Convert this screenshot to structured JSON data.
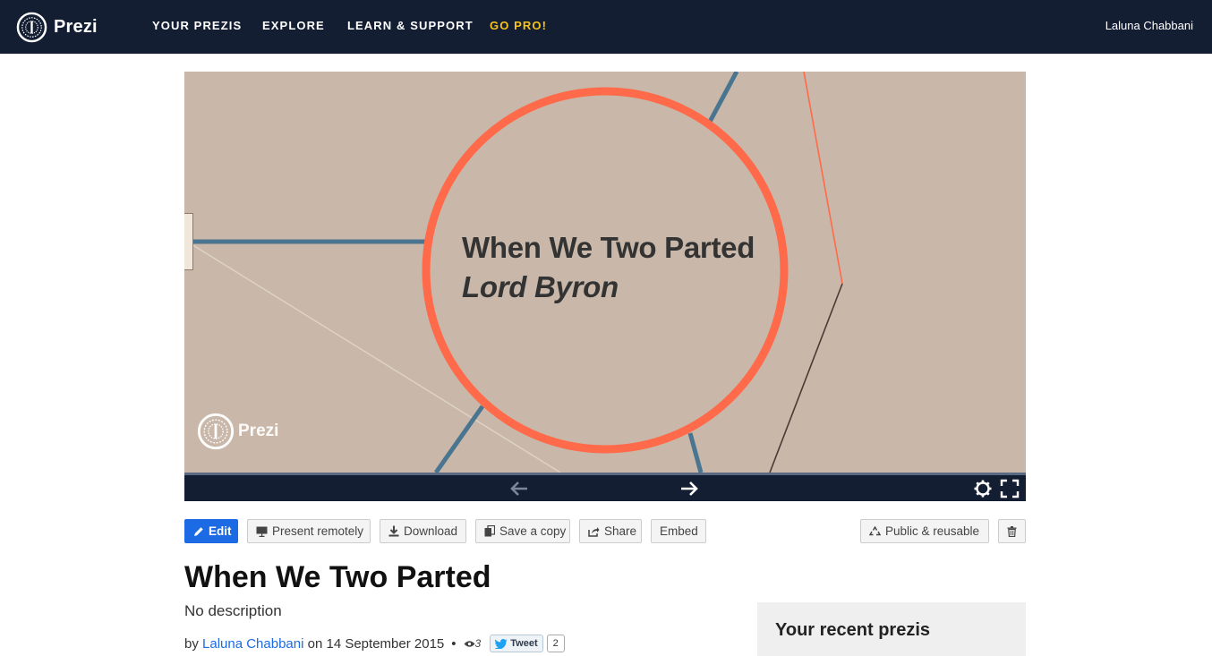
{
  "nav": {
    "logo_text": "Prezi",
    "items": [
      {
        "label": "YOUR PREZIS"
      },
      {
        "label": "EXPLORE"
      },
      {
        "label": "LEARN & SUPPORT"
      },
      {
        "label": "GO PRO!"
      }
    ],
    "user_name": "Laluna Chabbani"
  },
  "stage": {
    "title": "When We Two Parted",
    "subtitle": "Lord Byron",
    "watermark": "Prezi",
    "background_color": "#c9b8a9",
    "circle_color": "#ff6a4a",
    "line_color": "#4a7590"
  },
  "player": {
    "icons": [
      "arrow-left-icon",
      "arrow-right-icon",
      "settings-icon",
      "fullscreen-icon"
    ]
  },
  "actions": {
    "edit": "Edit",
    "present_remotely": "Present remotely",
    "download": "Download",
    "save_copy": "Save a copy",
    "share": "Share",
    "embed": "Embed",
    "public_reusable": "Public & reusable"
  },
  "info": {
    "title": "When We Two Parted",
    "description": "No description",
    "by": "by",
    "author": "Laluna Chabbani",
    "on": "on",
    "date": "14 September 2015",
    "views": "3",
    "tweet_label": "Tweet",
    "tweet_count": "2"
  },
  "recent": {
    "title": "Your recent prezis"
  },
  "colors": {
    "nav_bg": "#141e33",
    "accent": "#1d6ae5",
    "pro": "#f6c319"
  }
}
